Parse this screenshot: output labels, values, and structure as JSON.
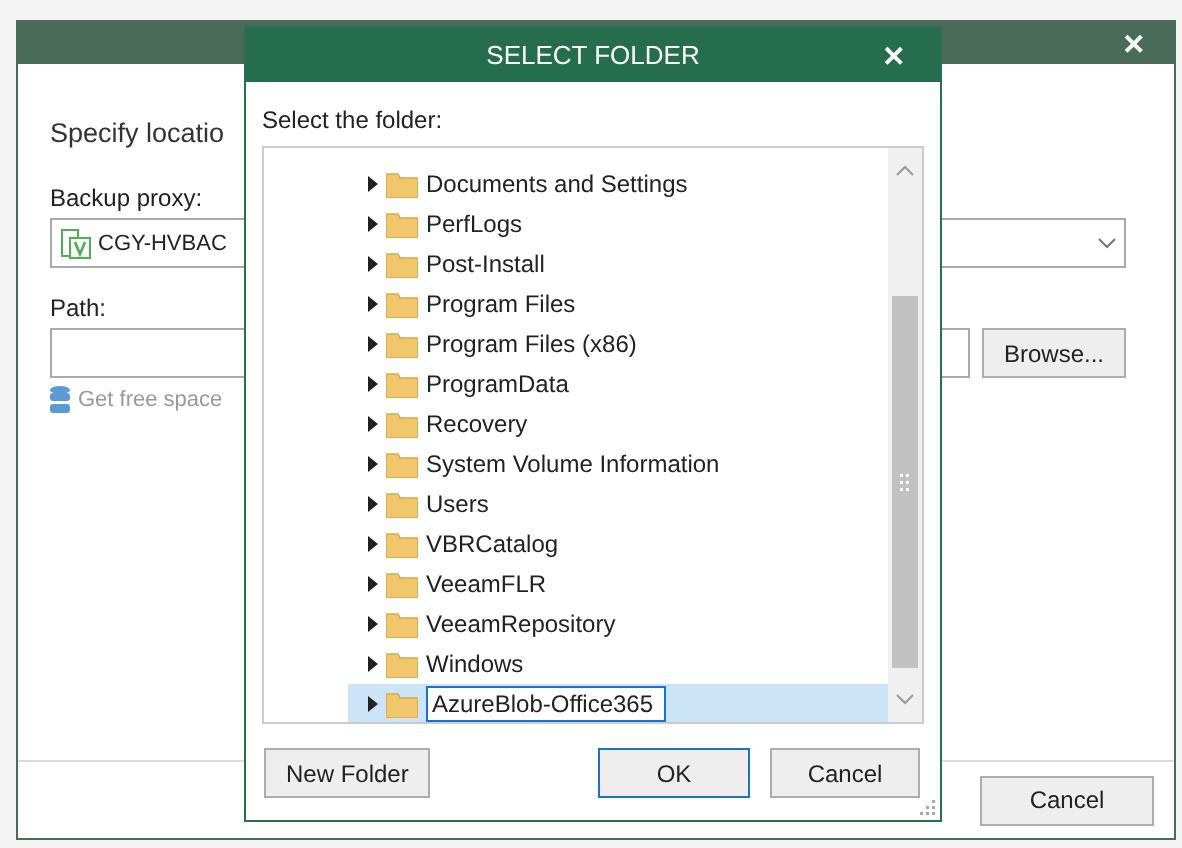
{
  "background_window": {
    "close": "✕",
    "heading": "Specify locatio",
    "proxy_label": "Backup proxy:",
    "proxy_value": "CGY-HVBAC",
    "path_label": "Path:",
    "browse_button": "Browse...",
    "free_space_link": "Get free space",
    "cancel_button": "Cancel"
  },
  "dialog": {
    "title": "SELECT FOLDER",
    "close": "✕",
    "prompt": "Select the folder:",
    "folders": [
      {
        "name": "Documents and Settings",
        "selected": false,
        "editing": false
      },
      {
        "name": "PerfLogs",
        "selected": false,
        "editing": false
      },
      {
        "name": "Post-Install",
        "selected": false,
        "editing": false
      },
      {
        "name": "Program Files",
        "selected": false,
        "editing": false
      },
      {
        "name": "Program Files (x86)",
        "selected": false,
        "editing": false
      },
      {
        "name": "ProgramData",
        "selected": false,
        "editing": false
      },
      {
        "name": "Recovery",
        "selected": false,
        "editing": false
      },
      {
        "name": "System Volume Information",
        "selected": false,
        "editing": false
      },
      {
        "name": "Users",
        "selected": false,
        "editing": false
      },
      {
        "name": "VBRCatalog",
        "selected": false,
        "editing": false
      },
      {
        "name": "VeeamFLR",
        "selected": false,
        "editing": false
      },
      {
        "name": "VeeamRepository",
        "selected": false,
        "editing": false
      },
      {
        "name": "Windows",
        "selected": false,
        "editing": false
      },
      {
        "name": "AzureBlob-Office365",
        "selected": true,
        "editing": true
      }
    ],
    "buttons": {
      "new_folder": "New Folder",
      "ok": "OK",
      "cancel": "Cancel"
    }
  }
}
